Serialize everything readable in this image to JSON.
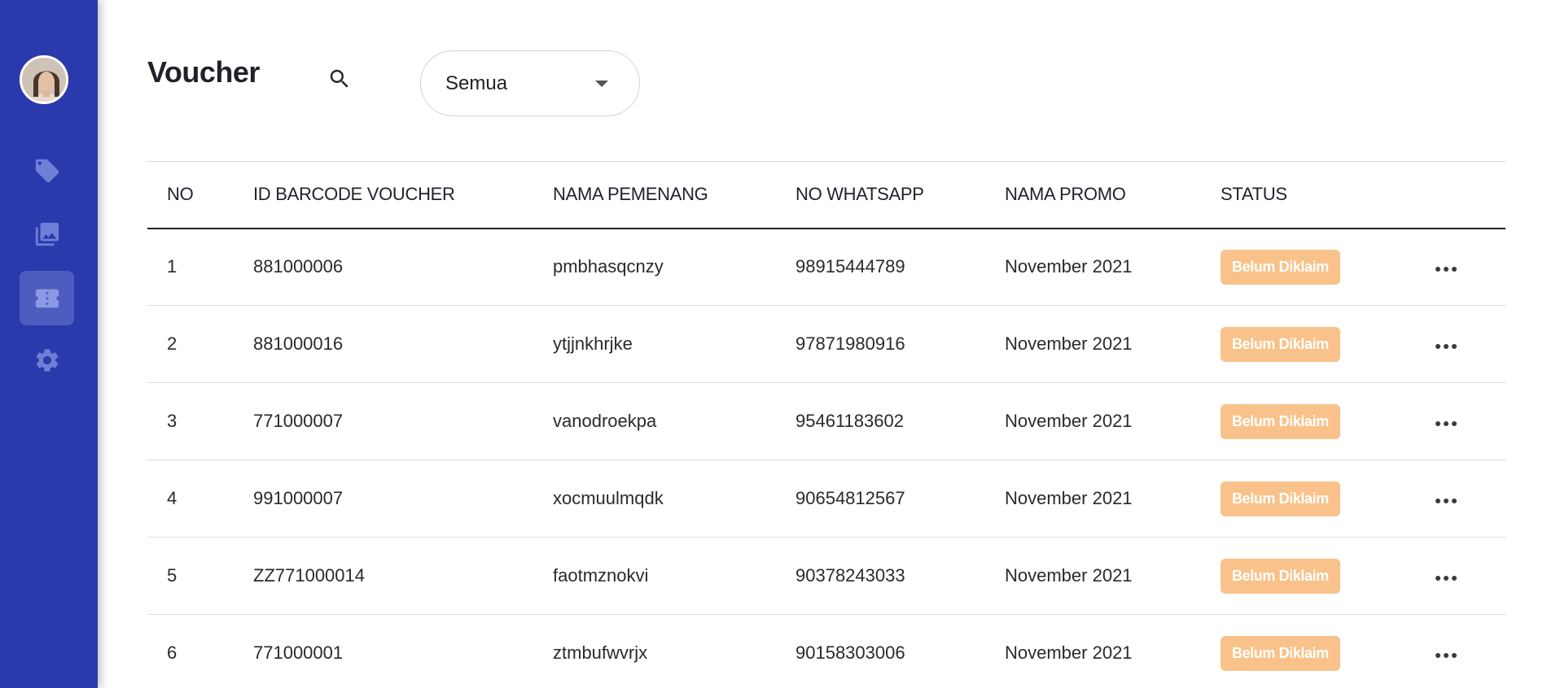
{
  "header": {
    "title": "Voucher",
    "filter": {
      "selected": "Semua"
    }
  },
  "sidebar": {
    "items": [
      {
        "icon": "tag-icon"
      },
      {
        "icon": "gallery-icon"
      },
      {
        "icon": "ticket-icon",
        "active": true
      },
      {
        "icon": "gear-icon"
      }
    ]
  },
  "table": {
    "columns": [
      "NO",
      "ID BARCODE VOUCHER",
      "NAMA PEMENANG",
      "NO WHATSAPP",
      "NAMA PROMO",
      "STATUS"
    ],
    "rows": [
      {
        "no": "1",
        "id": "881000006",
        "nama": "pmbhasqcnzy",
        "wa": "98915444789",
        "promo": "November 2021",
        "status": "Belum Diklaim"
      },
      {
        "no": "2",
        "id": "881000016",
        "nama": "ytjjnkhrjke",
        "wa": "97871980916",
        "promo": "November 2021",
        "status": "Belum Diklaim"
      },
      {
        "no": "3",
        "id": "771000007",
        "nama": "vanodroekpa",
        "wa": "95461183602",
        "promo": "November 2021",
        "status": "Belum Diklaim"
      },
      {
        "no": "4",
        "id": "991000007",
        "nama": "xocmuulmqdk",
        "wa": "90654812567",
        "promo": "November 2021",
        "status": "Belum Diklaim"
      },
      {
        "no": "5",
        "id": "ZZ771000014",
        "nama": "faotmznokvi",
        "wa": "90378243033",
        "promo": "November 2021",
        "status": "Belum Diklaim"
      },
      {
        "no": "6",
        "id": "771000001",
        "nama": "ztmbufwvrjx",
        "wa": "90158303006",
        "promo": "November 2021",
        "status": "Belum Diklaim"
      }
    ]
  },
  "colors": {
    "sidebar": "#2a3aad",
    "badge": "#f9c28a"
  }
}
